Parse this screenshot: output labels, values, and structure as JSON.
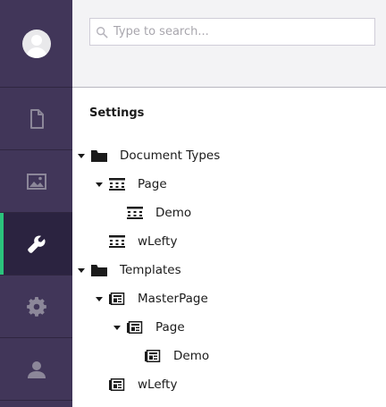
{
  "header": {
    "search_placeholder": "Type to search...",
    "search_value": ""
  },
  "rail": {
    "items": [
      {
        "name": "content",
        "icon": "document-icon",
        "active": false
      },
      {
        "name": "media",
        "icon": "image-icon",
        "active": false
      },
      {
        "name": "settings",
        "icon": "wrench-icon",
        "active": true
      },
      {
        "name": "developer",
        "icon": "gear-icon",
        "active": false
      },
      {
        "name": "users",
        "icon": "user-icon",
        "active": false
      }
    ]
  },
  "tree": {
    "section_title": "Settings",
    "nodes": [
      {
        "label": "Document Types",
        "icon": "folder-icon",
        "expanded": true
      },
      {
        "label": "Page",
        "icon": "document-type-icon",
        "expanded": true
      },
      {
        "label": "Demo",
        "icon": "document-type-icon",
        "expanded": false
      },
      {
        "label": "wLefty",
        "icon": "document-type-icon",
        "expanded": false
      },
      {
        "label": "Templates",
        "icon": "folder-icon",
        "expanded": true
      },
      {
        "label": "MasterPage",
        "icon": "template-icon",
        "expanded": true
      },
      {
        "label": "Page",
        "icon": "template-icon",
        "expanded": true
      },
      {
        "label": "Demo",
        "icon": "template-icon",
        "expanded": false
      },
      {
        "label": "wLefty",
        "icon": "template-icon",
        "expanded": false
      }
    ]
  },
  "colors": {
    "rail_bg": "#413659",
    "rail_active_bg": "#2b2340",
    "rail_active_accent": "#2bc37c",
    "header_bg": "#f3f3f5",
    "icon_inactive": "#8c8799",
    "icon_active": "#ffffff"
  }
}
